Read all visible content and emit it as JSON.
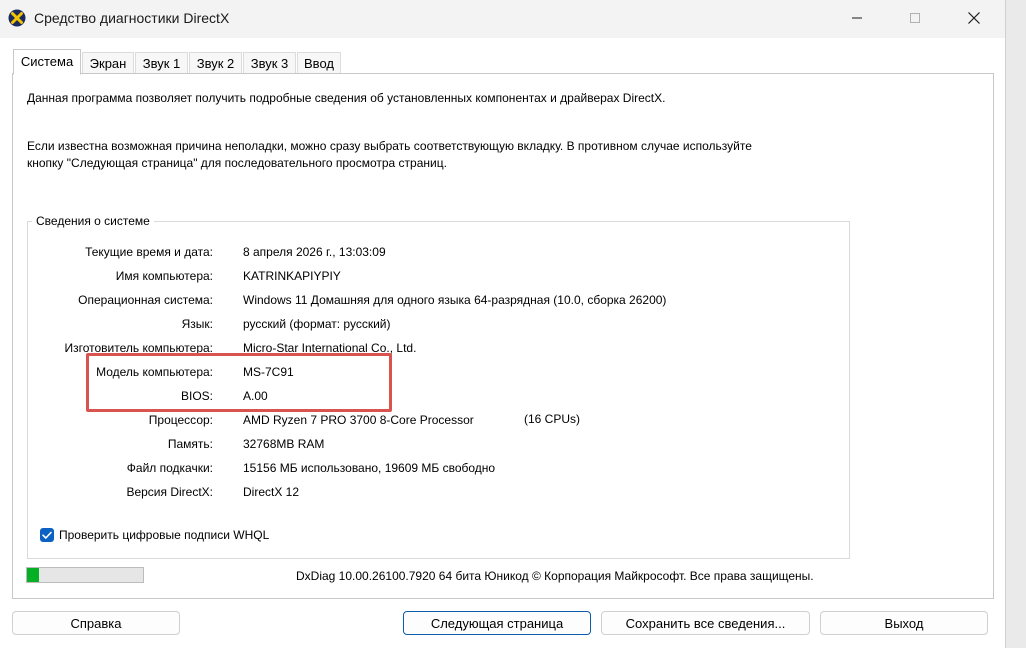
{
  "window": {
    "title": "Средство диагностики DirectX"
  },
  "tabs": [
    {
      "label": "Система",
      "active": true
    },
    {
      "label": "Экран"
    },
    {
      "label": "Звук 1"
    },
    {
      "label": "Звук 2"
    },
    {
      "label": "Звук 3"
    },
    {
      "label": "Ввод"
    }
  ],
  "intro": {
    "line1": "Данная программа позволяет получить подробные сведения об установленных компонентах и драйверах DirectX.",
    "line2": "Если известна возможная причина неполадки, можно сразу выбрать соответствующую вкладку. В противном случае используйте",
    "line3": "кнопку \"Следующая страница\" для последовательного просмотра страниц."
  },
  "system_info": {
    "legend": "Сведения о системе",
    "rows": [
      {
        "label": "Текущие время и дата:",
        "value": "8 апреля 2026 г., 13:03:09"
      },
      {
        "label": "Имя компьютера:",
        "value": "KATRINKAPIYPIY"
      },
      {
        "label": "Операционная система:",
        "value": "Windows 11 Домашняя для одного языка 64-разрядная (10.0, сборка 26200)"
      },
      {
        "label": "Язык:",
        "value": "русский (формат: русский)"
      },
      {
        "label": "Изготовитель компьютера:",
        "value": "Micro-Star International Co., Ltd."
      },
      {
        "label": "Модель компьютера:",
        "value": "MS-7C91"
      },
      {
        "label": "BIOS:",
        "value": "A.00"
      },
      {
        "label": "Процессор:",
        "value": "AMD Ryzen 7 PRO 3700 8-Core Processor"
      },
      {
        "label": "Память:",
        "value": "32768MB RAM"
      },
      {
        "label": "Файл подкачки:",
        "value": "15156 МБ использовано, 19609 МБ свободно"
      },
      {
        "label": "Версия DirectX:",
        "value": "DirectX 12"
      }
    ],
    "cpu_count": "(16 CPUs)"
  },
  "whql": {
    "label": "Проверить цифровые подписи WHQL",
    "checked": true
  },
  "progress": {
    "fraction": 0.1
  },
  "footer": {
    "copyright": "DxDiag 10.00.26100.7920 64 бита Юникод © Корпорация Майкрософт. Все права защищены."
  },
  "buttons": {
    "help": "Справка",
    "next": "Следующая страница",
    "save": "Сохранить все сведения...",
    "exit": "Выход"
  },
  "colors": {
    "accent": "#0b62c4",
    "highlight": "#d9534f",
    "progress": "#06b025"
  },
  "icons": {
    "app": "directx-icon",
    "minimize": "minimize-icon",
    "maximize": "maximize-icon",
    "close": "close-icon",
    "check": "checkmark-icon"
  }
}
